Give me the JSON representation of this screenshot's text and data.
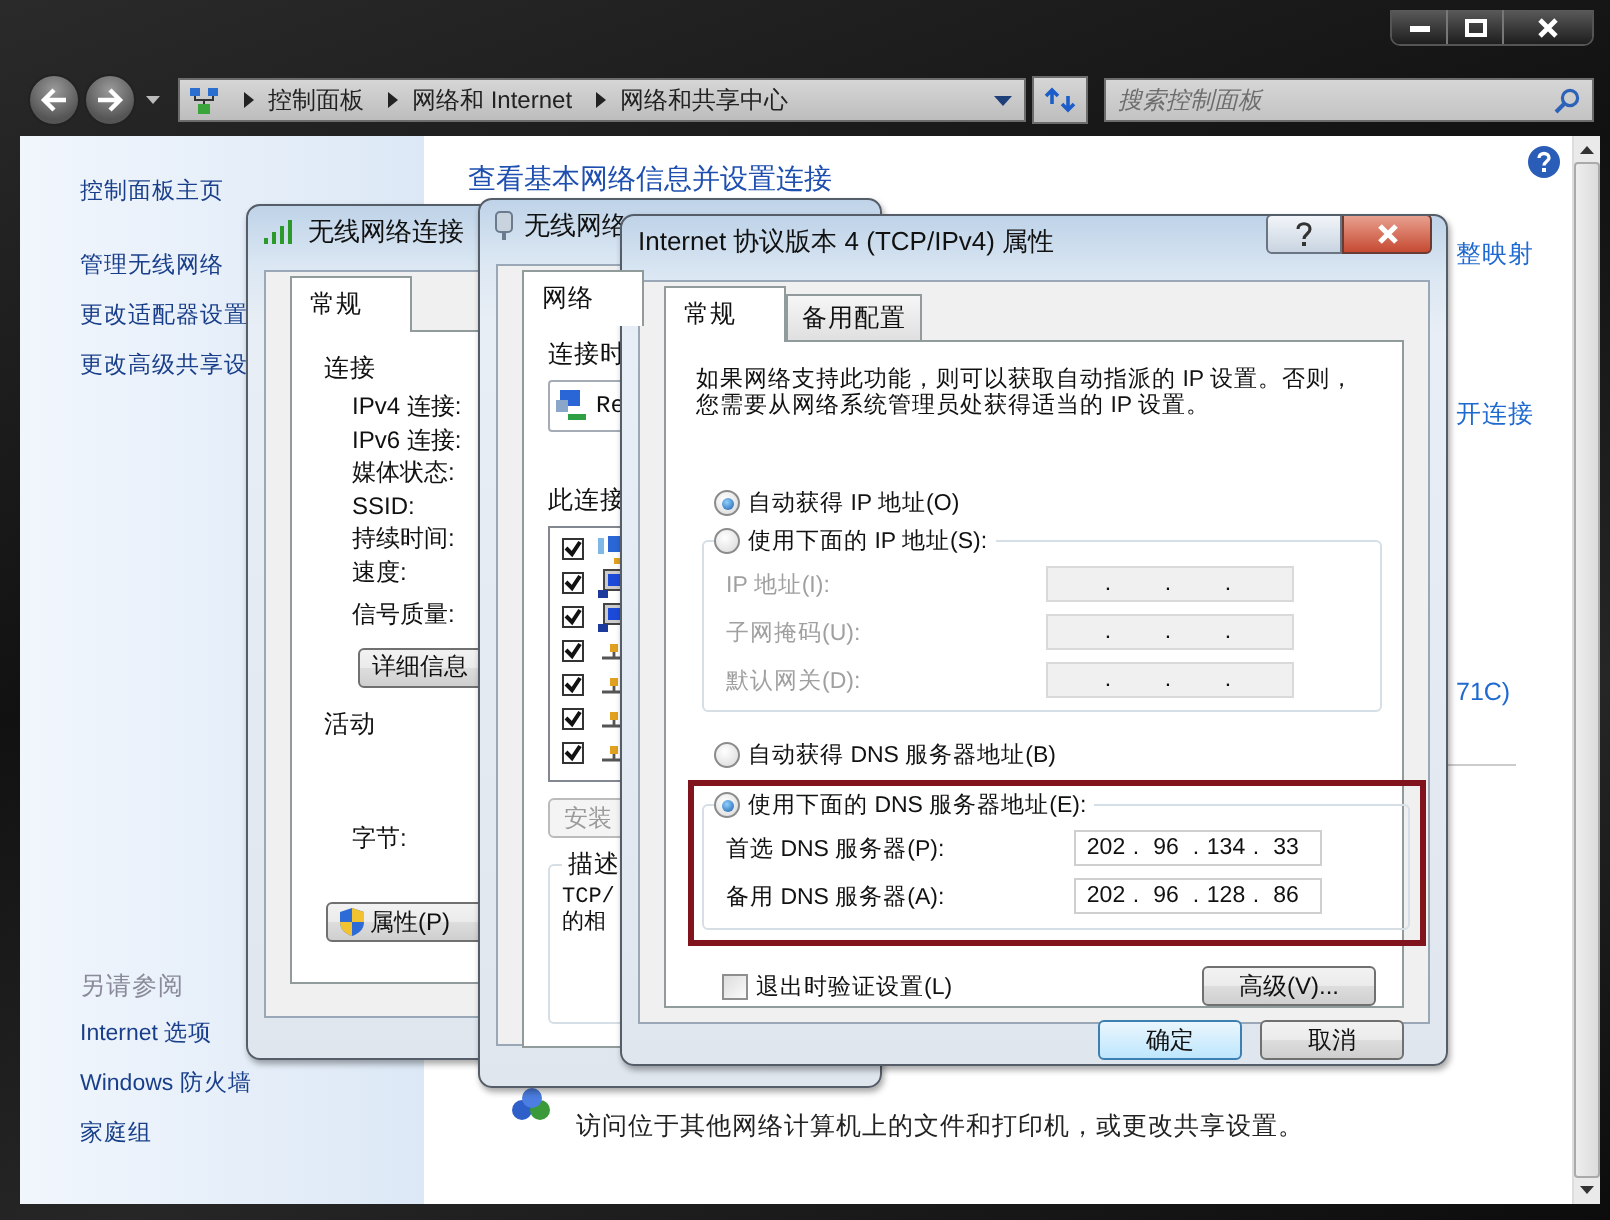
{
  "address_bar": {
    "breadcrumb": [
      "控制面板",
      "网络和 Internet",
      "网络和共享中心"
    ]
  },
  "search": {
    "placeholder": "搜索控制面板"
  },
  "sidebar": {
    "links": [
      "控制面板主页",
      "管理无线网络",
      "更改适配器设置",
      "更改高级共享设"
    ],
    "see_also_title": "另请参阅",
    "see_also": [
      "Internet 选项",
      "Windows 防火墙",
      "家庭组"
    ]
  },
  "main": {
    "heading": "查看基本网络信息并设置连接",
    "map_link": "整映射",
    "disconnect_link": "开连接",
    "connection_tail": "71C)",
    "footer_text": "访问位于其他网络计算机上的文件和打印机，或更改共享设置。"
  },
  "status_dialog": {
    "title": "无线网络连接",
    "tabs": [
      {
        "label": "常规",
        "selected": true
      }
    ],
    "connection_title": "连接",
    "connection_labels": [
      "IPv4 连接:",
      "IPv6 连接:",
      "媒体状态:",
      "SSID:",
      "持续时间:",
      "速度:",
      "信号质量:"
    ],
    "details_button": "详细信息",
    "activity_title": "活动",
    "bytes_label": "字节:",
    "properties_button": "属性(P)"
  },
  "properties_dialog": {
    "title": "无线网络",
    "tabs": [
      {
        "label": "网络",
        "selected": true
      }
    ],
    "connect_using": "连接时",
    "adapter": "Re",
    "items_title": "此连接",
    "items": [
      {
        "kind": "client",
        "checked": true
      },
      {
        "kind": "service",
        "checked": true
      },
      {
        "kind": "service",
        "checked": true
      },
      {
        "kind": "protocol",
        "checked": true
      },
      {
        "kind": "protocol",
        "checked": true
      },
      {
        "kind": "protocol",
        "checked": true
      },
      {
        "kind": "protocol",
        "checked": true
      }
    ],
    "install_button": {
      "label": "安装",
      "disabled": true
    },
    "description_title": "描述",
    "description_lines": [
      "TCP/",
      "的相"
    ]
  },
  "ipv4_dialog": {
    "title": "Internet 协议版本 4 (TCP/IPv4) 属性",
    "tabs": [
      {
        "label": "常规",
        "selected": true
      },
      {
        "label": "备用配置",
        "selected": false
      }
    ],
    "intro_lines": [
      "如果网络支持此功能，则可以获取自动指派的 IP 设置。否则，",
      "您需要从网络系统管理员处获得适当的 IP 设置。"
    ],
    "separator": ".",
    "ip_mode": [
      {
        "label": "自动获得 IP 地址(O)",
        "selected": true
      },
      {
        "label": "使用下面的 IP 地址(S):",
        "selected": false
      }
    ],
    "ip_fields": [
      {
        "label": "IP 地址(I):",
        "disabled": true
      },
      {
        "label": "子网掩码(U):",
        "disabled": true
      },
      {
        "label": "默认网关(D):",
        "disabled": true
      }
    ],
    "dns_mode": [
      {
        "label": "自动获得 DNS 服务器地址(B)",
        "selected": false
      },
      {
        "label": "使用下面的 DNS 服务器地址(E):",
        "selected": true
      }
    ],
    "dns_fields": [
      {
        "label": "首选 DNS 服务器(P):",
        "disabled": false,
        "octets": [
          "202",
          "96",
          "134",
          "33"
        ]
      },
      {
        "label": "备用 DNS 服务器(A):",
        "disabled": false,
        "octets": [
          "202",
          "96",
          "128",
          "86"
        ]
      }
    ],
    "validate": {
      "label": "退出时验证设置(L)",
      "checked": false
    },
    "advanced_button": "高级(V)...",
    "buttons": [
      {
        "label": "确定",
        "default": true
      },
      {
        "label": "取消",
        "default": false
      }
    ]
  }
}
